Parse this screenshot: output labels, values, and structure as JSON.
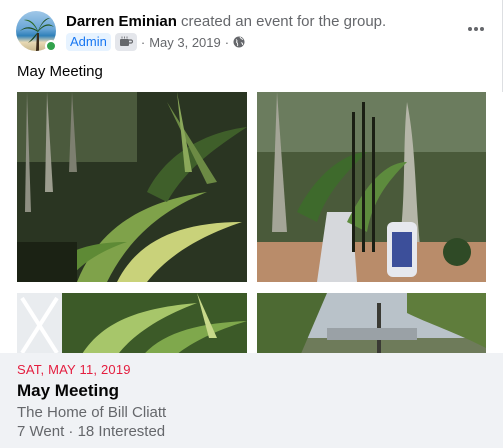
{
  "post": {
    "author": "Darren Eminian",
    "action": "created an event for the group.",
    "badge_admin": "Admin",
    "badge_icon": "coffee-cup-icon",
    "separator": "·",
    "date": "May 3, 2019",
    "privacy_icon": "globe-icon",
    "online_status": "online",
    "text": "May Meeting"
  },
  "event": {
    "date": "SAT, MAY 11, 2019",
    "title": "May Meeting",
    "location": "The Home of Bill Cliatt",
    "stats": "7 Went · 18 Interested"
  },
  "colors": {
    "accent_blue": "#1877f2",
    "event_date_red": "#e41e3f",
    "online_green": "#31a24c",
    "secondary_text": "#65676b",
    "card_background": "#f0f2f5"
  }
}
